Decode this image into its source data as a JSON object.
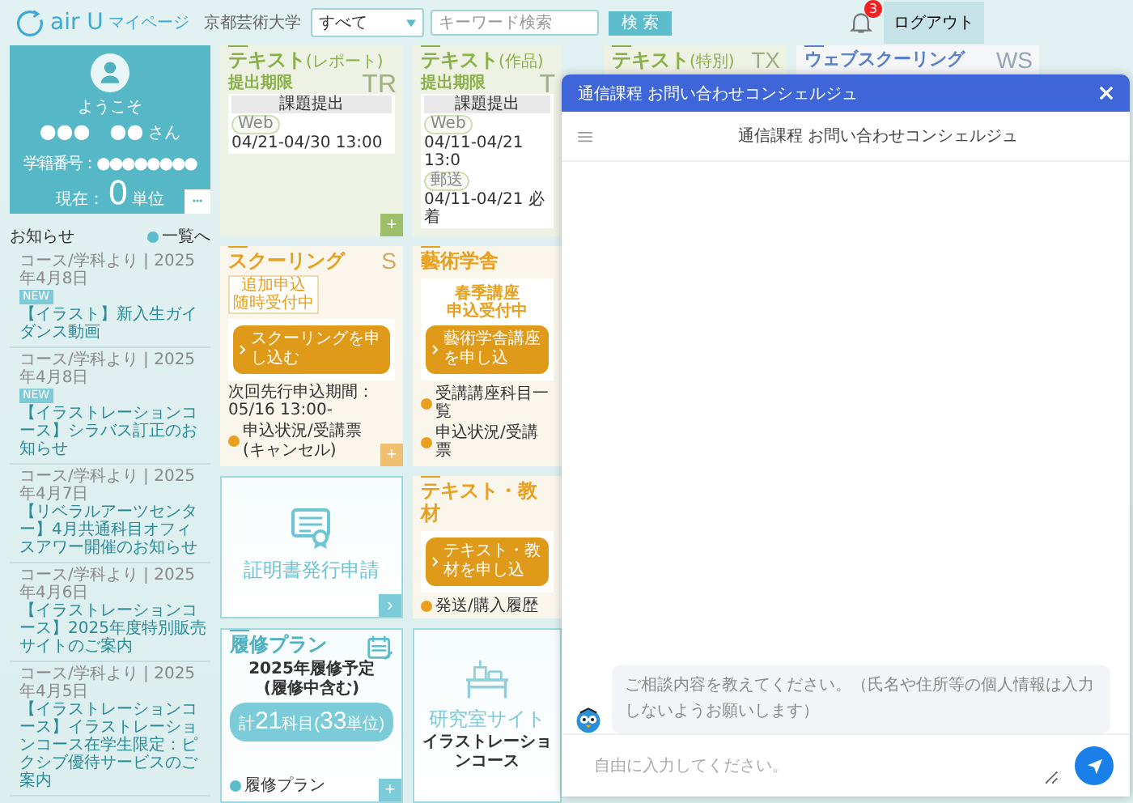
{
  "header": {
    "logo": "air U",
    "page_label": "マイページ",
    "university": "京都芸術大学",
    "search_scope": "すべて",
    "search_placeholder": "キーワード検索",
    "search_button": "検 索",
    "notification_count": "3",
    "logout": "ログアウト"
  },
  "profile": {
    "welcome": "ようこそ",
    "name": "●●●　●●",
    "honorific": "さん",
    "student_id": "学籍番号：●●●●●●●●",
    "credits_label": "現在：",
    "credits_value": "0",
    "credits_unit": "単位",
    "more_button": "•••"
  },
  "news": {
    "title": "お知らせ",
    "list_link": "一覧へ",
    "items": [
      {
        "meta": "コース/学科より | 2025年4月8日",
        "badge": "NEW",
        "title": "【イラスト】新入生ガイダンス動画"
      },
      {
        "meta": "コース/学科より | 2025年4月8日",
        "badge": "NEW",
        "title": "【イラストレーションコース】シラバス訂正のお知らせ"
      },
      {
        "meta": "コース/学科より | 2025年4月7日",
        "title": "【リベラルアーツセンター】4月共通科目オフィスアワー開催のお知らせ"
      },
      {
        "meta": "コース/学科より | 2025年4月6日",
        "title": "【イラストレーションコース】2025年度特別販売サイトのご案内"
      },
      {
        "meta": "コース/学科より | 2025年4月5日",
        "title": "【イラストレーションコース】イラストレーションコース在学生限定：ピクシブ優待サービスのご案内"
      }
    ]
  },
  "text_report": {
    "title": "テキスト",
    "title_sub": "(レポート)",
    "watermark": "TR",
    "deadline_label": "提出期限",
    "table_header": "課題提出",
    "rows": [
      {
        "tag": "Web",
        "period": "04/21-04/30 13:00"
      }
    ],
    "plus_button": "+"
  },
  "text_work": {
    "title": "テキスト",
    "title_sub": "(作品)",
    "watermark": "T",
    "deadline_label": "提出期限",
    "table_header": "課題提出",
    "rows": [
      {
        "tag": "Web",
        "period": "04/11-04/21 13:0"
      },
      {
        "tag": "郵送",
        "period": "04/11-04/21 必着"
      }
    ]
  },
  "text_special": {
    "title": "テキスト",
    "title_sub": "(特別)",
    "watermark": "TX"
  },
  "web_schooling": {
    "title": "ウェブスクーリング",
    "watermark": "WS"
  },
  "schooling": {
    "title": "スクーリング",
    "watermark": "S",
    "badge_lines": [
      "追加申込",
      "随時受付中"
    ],
    "button": "スクーリングを申し込む",
    "note": "次回先行申込期間：05/16 13:00-",
    "link": "申込状況/受講票(キャンセル)",
    "plus_button": "+"
  },
  "art_school": {
    "title": "藝術学舎",
    "notice_lines": [
      "春季講座",
      "申込受付中"
    ],
    "button": "藝術学舎講座を申し込",
    "links": [
      "受講講座科目一覧",
      "申込状況/受講票"
    ]
  },
  "certificate": {
    "label": "証明書発行申請",
    "arrow_button": "›"
  },
  "text_materials": {
    "title": "テキスト・教材",
    "button": "テキスト・教材を申し込",
    "link": "発送/購入履歴"
  },
  "study_plan": {
    "title": "履修プラン",
    "heading_lines": [
      "2025年履修予定",
      "(履修中含む)"
    ],
    "total_prefix": "計",
    "subjects": "21",
    "subjects_unit": "科目",
    "paren": "(",
    "credits": "33",
    "credits_unit": "単位)",
    "link": "履修プラン",
    "plus_button": "+"
  },
  "lab_site": {
    "title": "研究室サイト",
    "subtitle": "イラストレーションコース"
  },
  "chat": {
    "title": "通信課程 お問い合わせコンシェルジュ",
    "subheader": "通信課程 お問い合わせコンシェルジュ",
    "message": "ご相談内容を教えてください。（氏名や住所等の個人情報は入力しないようお願いします）",
    "placeholder": "自由に入力してください。"
  }
}
